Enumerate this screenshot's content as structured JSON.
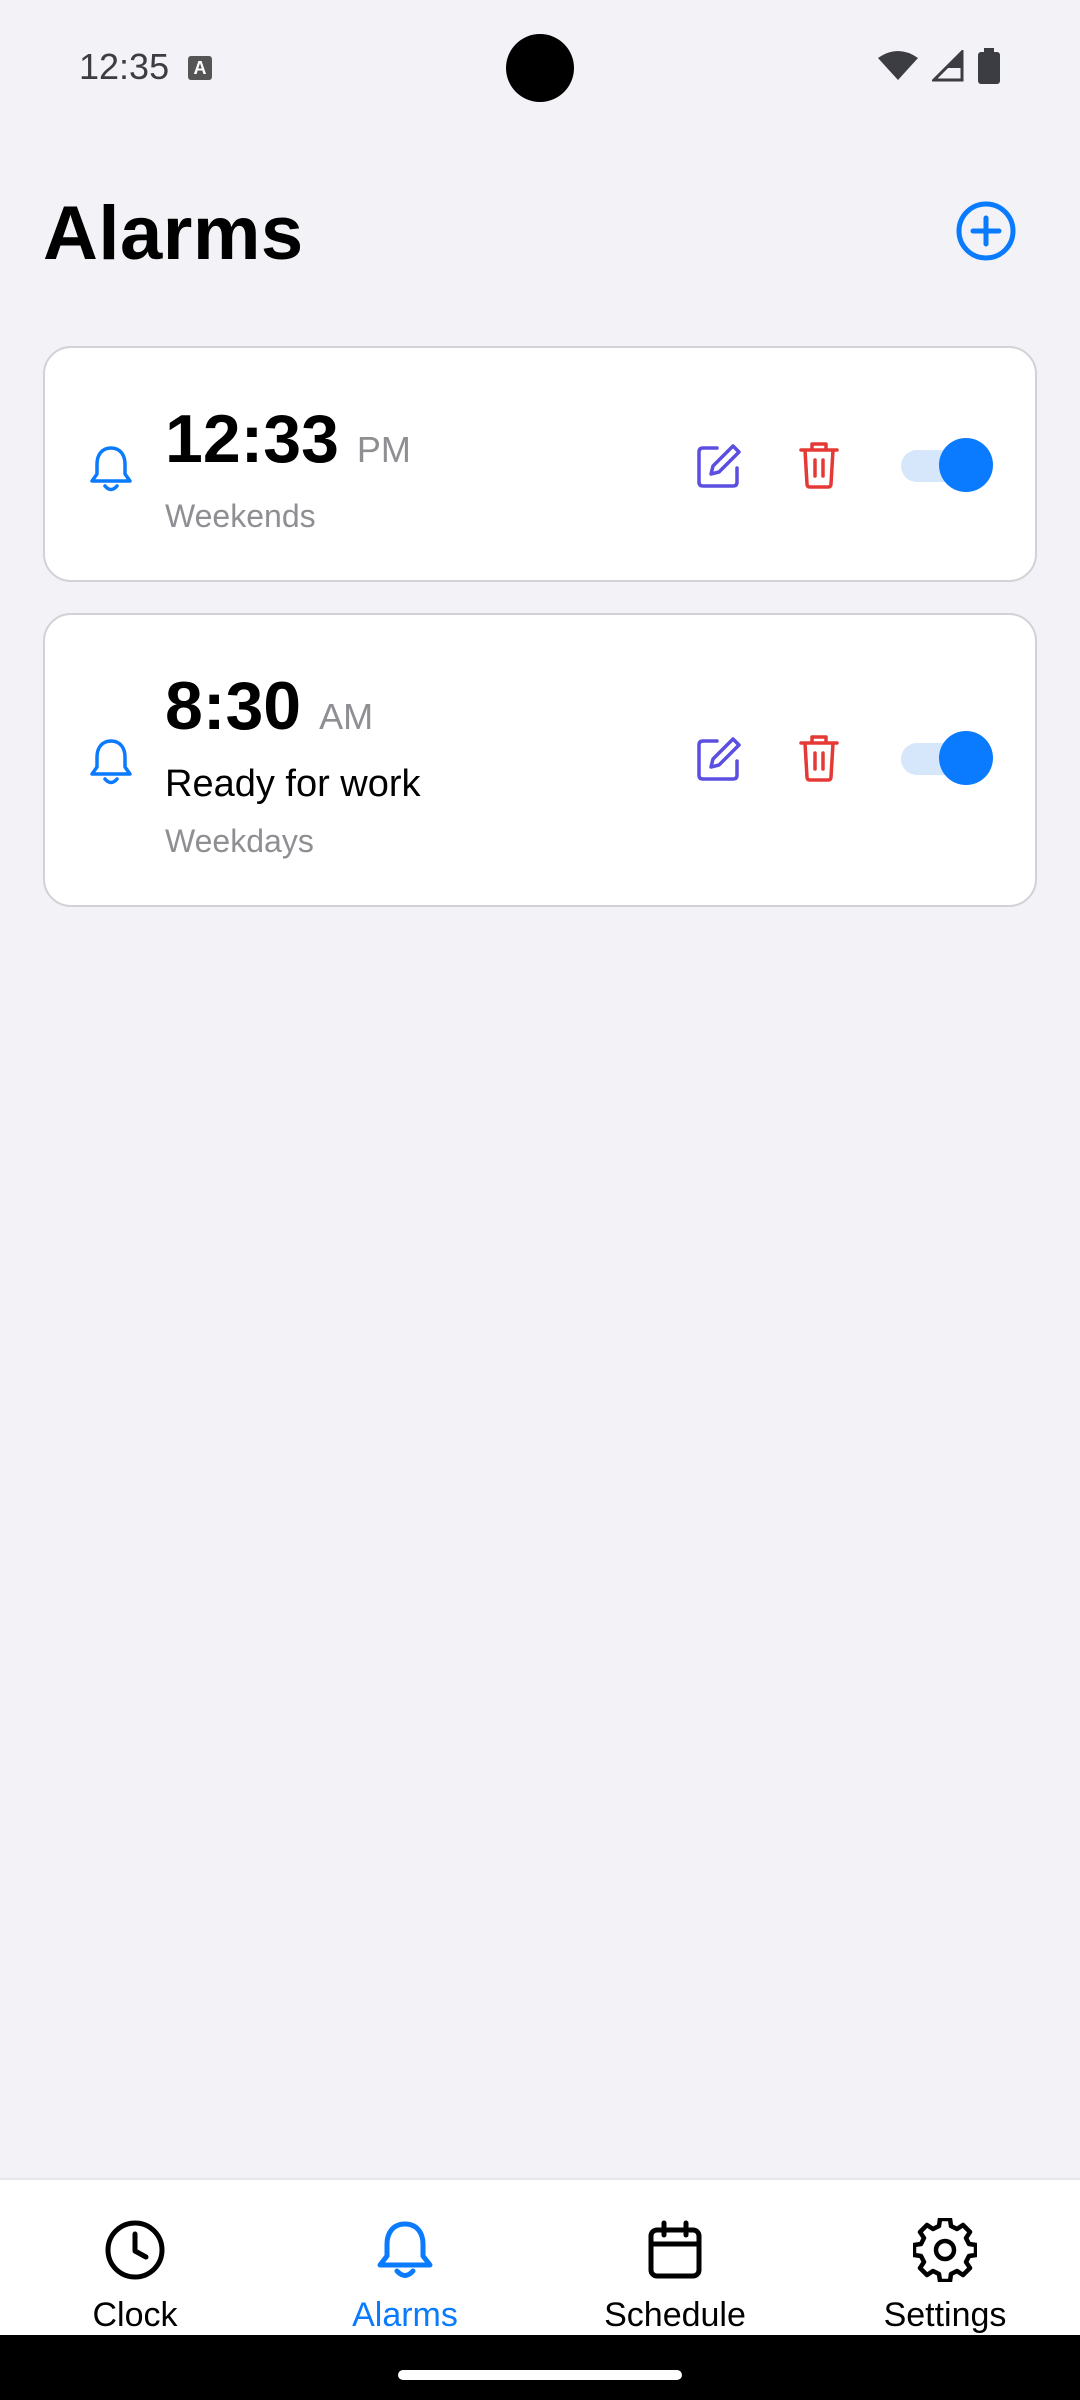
{
  "status_bar": {
    "time": "12:35"
  },
  "header": {
    "title": "Alarms"
  },
  "alarms": [
    {
      "time": "12:33",
      "ampm": "PM",
      "label": "",
      "repeat": "Weekends",
      "enabled": true
    },
    {
      "time": "8:30",
      "ampm": "AM",
      "label": "Ready for work",
      "repeat": "Weekdays",
      "enabled": true
    }
  ],
  "nav": {
    "items": [
      {
        "label": "Clock",
        "icon": "clock-icon"
      },
      {
        "label": "Alarms",
        "icon": "bell-icon",
        "active": true
      },
      {
        "label": "Schedule",
        "icon": "calendar-icon"
      },
      {
        "label": "Settings",
        "icon": "gear-icon"
      }
    ]
  },
  "colors": {
    "accent": "#0A7AFF",
    "edit": "#5A4FE0",
    "delete": "#E53935",
    "background": "#F2F2F7"
  }
}
